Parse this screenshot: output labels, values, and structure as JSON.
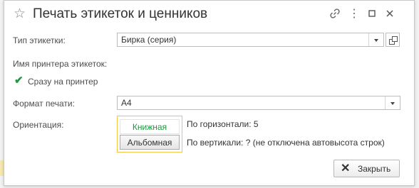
{
  "window": {
    "title": "Печать этикеток и ценников",
    "toolbar_icons": [
      "star-icon",
      "link-icon",
      "more-icon",
      "maximize-icon",
      "close-icon"
    ]
  },
  "fields": {
    "label_type": {
      "label": "Тип этикетки:",
      "value": "Бирка (серия)"
    },
    "printer_name": {
      "label": "Имя принтера этикеток:"
    },
    "direct_print": {
      "label": "Сразу на принтер",
      "checked": true
    },
    "print_format": {
      "label": "Формат печати:",
      "value": "А4"
    },
    "orientation": {
      "label": "Ориентация:",
      "options": [
        "Книжная",
        "Альбомная"
      ],
      "selected": "Книжная"
    }
  },
  "info": {
    "horizontal": "По горизонтали: 5",
    "vertical": "По вертикали: ? (не отключена автовысота строк)"
  },
  "buttons": {
    "close": "Закрыть"
  },
  "colors": {
    "accent_green": "#1a9a3e",
    "focus_border": "#f1c54a"
  }
}
